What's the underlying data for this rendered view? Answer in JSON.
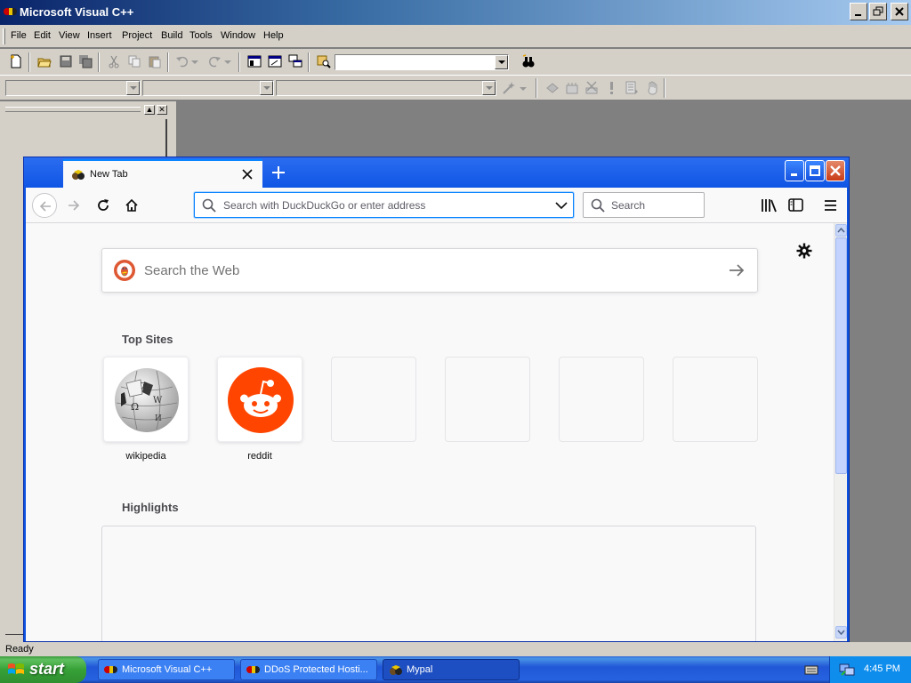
{
  "vc": {
    "title": "Microsoft Visual C++",
    "menu": [
      "File",
      "Edit",
      "View",
      "Insert",
      "Project",
      "Build",
      "Tools",
      "Window",
      "Help"
    ],
    "status": "Ready"
  },
  "firefox": {
    "tab_title": "New Tab",
    "url_placeholder": "Search with DuckDuckGo or enter address",
    "search_placeholder": "Search",
    "web_search_placeholder": "Search the Web",
    "top_sites_title": "Top Sites",
    "top_sites": [
      {
        "label": "wikipedia",
        "icon": "wikipedia-globe-icon"
      },
      {
        "label": "reddit",
        "icon": "reddit-alien-icon"
      },
      {
        "label": "",
        "icon": ""
      },
      {
        "label": "",
        "icon": ""
      },
      {
        "label": "",
        "icon": ""
      },
      {
        "label": "",
        "icon": ""
      }
    ],
    "highlights_title": "Highlights",
    "accent": "#0a84ff"
  },
  "taskbar": {
    "start_label": "start",
    "tasks": [
      {
        "label": "Microsoft Visual C++",
        "icon": "visual-cpp-icon"
      },
      {
        "label": "DDoS Protected Hosti...",
        "icon": "visual-cpp-icon"
      },
      {
        "label": "Mypal",
        "icon": "mypal-icon"
      }
    ],
    "clock": "4:45 PM"
  }
}
